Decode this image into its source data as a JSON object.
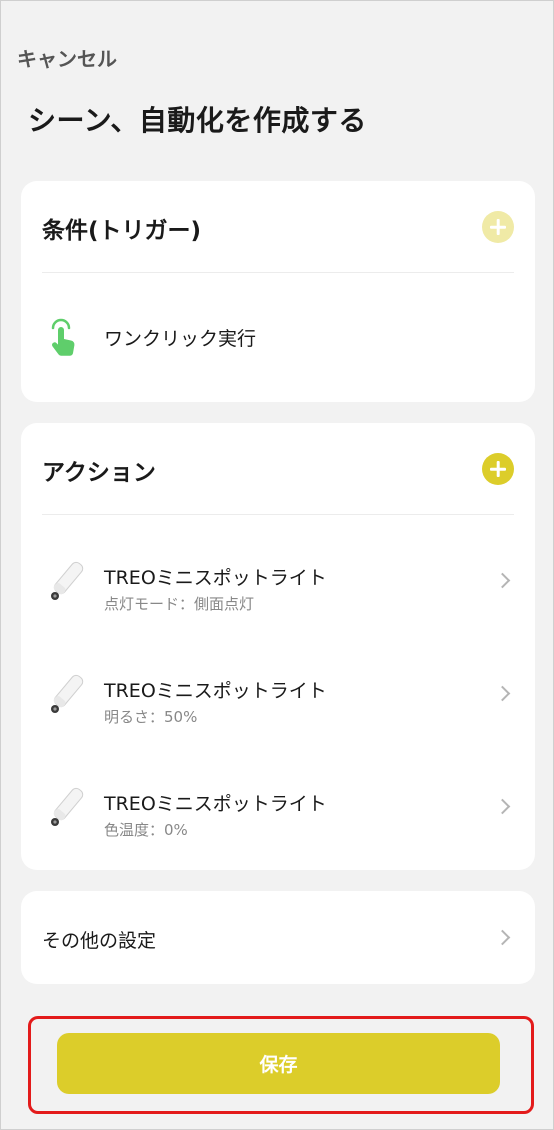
{
  "header": {
    "cancel_label": "キャンセル",
    "title": "シーン、自動化を作成する"
  },
  "conditions": {
    "title": "条件(トリガー)",
    "item_label": "ワンクリック実行"
  },
  "actions": {
    "title": "アクション",
    "items": [
      {
        "name": "TREOミニスポットライト",
        "detail": "点灯モード：側面点灯"
      },
      {
        "name": "TREOミニスポットライト",
        "detail": "明るさ：50%"
      },
      {
        "name": "TREOミニスポットライト",
        "detail": "色温度：0%"
      }
    ]
  },
  "other": {
    "label": "その他の設定"
  },
  "save": {
    "label": "保存"
  },
  "colors": {
    "accent": "#dccd2a",
    "accent_faded": "#f0eaa6",
    "highlight_border": "#e31b1b",
    "trigger_icon": "#5fce6b"
  }
}
